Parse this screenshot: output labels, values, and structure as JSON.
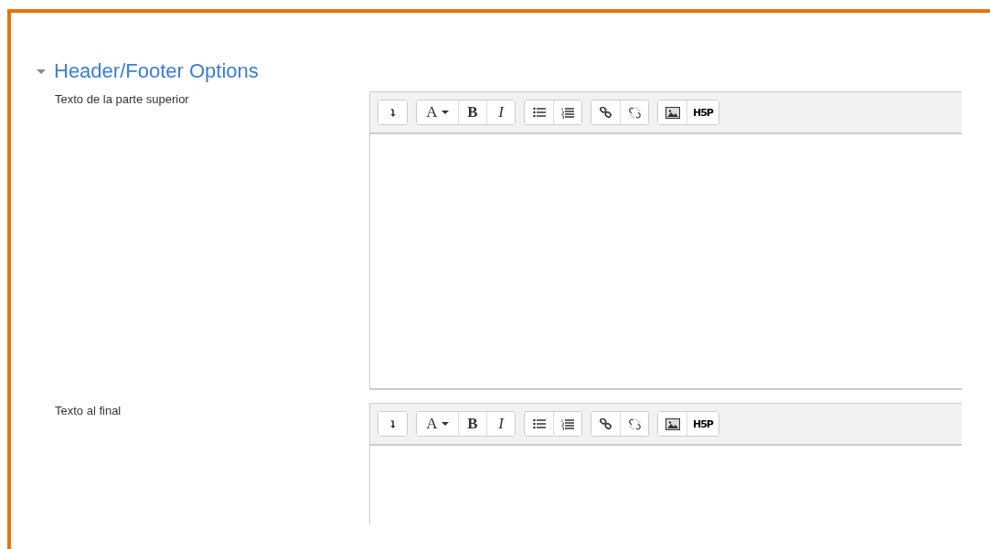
{
  "section": {
    "title": "Header/Footer Options",
    "expanded": true,
    "fields": [
      {
        "label": "Texto de la parte superior",
        "toolbar": [
          [
            {
              "kind": "expand"
            }
          ],
          [
            {
              "kind": "font",
              "label": "A"
            },
            {
              "kind": "bold",
              "label": "B"
            },
            {
              "kind": "italic",
              "label": "I"
            }
          ],
          [
            {
              "kind": "bullets"
            },
            {
              "kind": "numbers"
            }
          ],
          [
            {
              "kind": "link"
            },
            {
              "kind": "unlink"
            }
          ],
          [
            {
              "kind": "image"
            },
            {
              "kind": "h5p",
              "label": "H5P"
            }
          ]
        ]
      },
      {
        "label": "Texto al final",
        "toolbar": [
          [
            {
              "kind": "expand"
            }
          ],
          [
            {
              "kind": "font",
              "label": "A"
            },
            {
              "kind": "bold",
              "label": "B"
            },
            {
              "kind": "italic",
              "label": "I"
            }
          ],
          [
            {
              "kind": "bullets"
            },
            {
              "kind": "numbers"
            }
          ],
          [
            {
              "kind": "link"
            },
            {
              "kind": "unlink"
            }
          ],
          [
            {
              "kind": "image"
            },
            {
              "kind": "h5p",
              "label": "H5P"
            }
          ]
        ]
      }
    ]
  }
}
